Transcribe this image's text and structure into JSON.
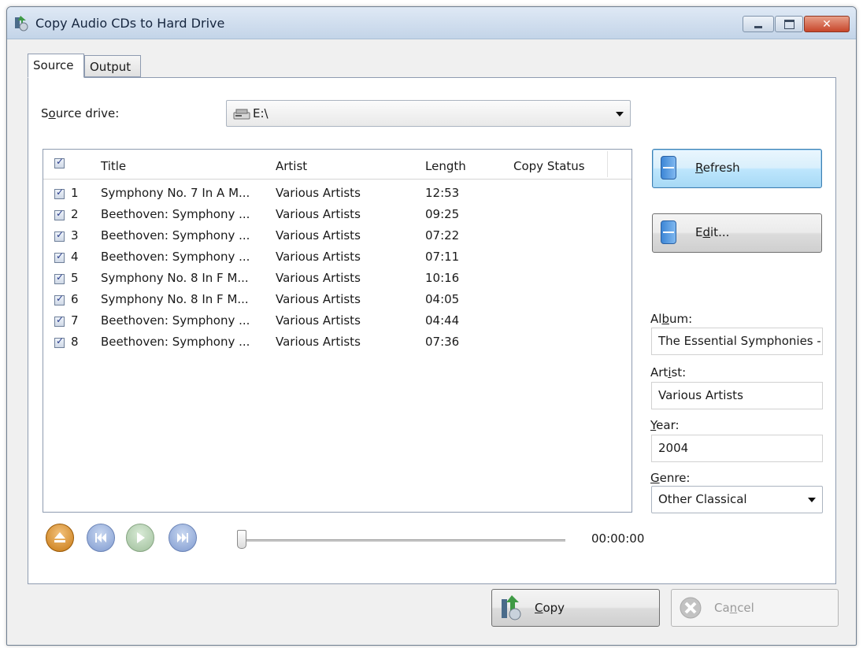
{
  "window": {
    "title": "Copy Audio CDs to Hard Drive",
    "controls": [
      "minimize",
      "maximize",
      "close"
    ]
  },
  "tabs": [
    {
      "label": "Source",
      "active": true
    },
    {
      "label": "Output",
      "active": false
    }
  ],
  "source": {
    "drive_label": "Source drive:",
    "drive_value": "E:\\",
    "drive_icon": "cd-drive-icon"
  },
  "tracklist": {
    "columns": [
      "Title",
      "Artist",
      "Length",
      "Copy Status"
    ],
    "all_checked": true,
    "rows": [
      {
        "num": "1",
        "checked": true,
        "title": "Symphony No. 7 In A M...",
        "artist": "Various Artists",
        "length": "12:53",
        "status": ""
      },
      {
        "num": "2",
        "checked": true,
        "title": "Beethoven: Symphony ...",
        "artist": "Various Artists",
        "length": "09:25",
        "status": ""
      },
      {
        "num": "3",
        "checked": true,
        "title": "Beethoven: Symphony ...",
        "artist": "Various Artists",
        "length": "07:22",
        "status": ""
      },
      {
        "num": "4",
        "checked": true,
        "title": "Beethoven: Symphony ...",
        "artist": "Various Artists",
        "length": "07:11",
        "status": ""
      },
      {
        "num": "5",
        "checked": true,
        "title": "Symphony No. 8 In F M...",
        "artist": "Various Artists",
        "length": "10:16",
        "status": ""
      },
      {
        "num": "6",
        "checked": true,
        "title": "Symphony No. 8 In F M...",
        "artist": "Various Artists",
        "length": "04:05",
        "status": ""
      },
      {
        "num": "7",
        "checked": true,
        "title": "Beethoven: Symphony ...",
        "artist": "Various Artists",
        "length": "04:44",
        "status": ""
      },
      {
        "num": "8",
        "checked": true,
        "title": "Beethoven: Symphony ...",
        "artist": "Various Artists",
        "length": "07:36",
        "status": ""
      }
    ]
  },
  "player": {
    "time": "00:00:00",
    "position": 0,
    "buttons": [
      "eject-icon",
      "previous-track-icon",
      "play-icon",
      "next-track-icon"
    ]
  },
  "actions": {
    "refresh": "Refresh",
    "edit": "Edit..."
  },
  "metadata": {
    "album_label": "Album:",
    "album_value": "The Essential Symphonies -",
    "artist_label": "Artist:",
    "artist_value": "Various Artists",
    "year_label": "Year:",
    "year_value": "2004",
    "genre_label": "Genre:",
    "genre_value": "Other Classical"
  },
  "footer": {
    "copy": "Copy",
    "cancel": "Cancel"
  },
  "colors": {
    "titlebar": "#c3d4e8",
    "accent": "#3c7fb1",
    "close": "#c7462a"
  }
}
